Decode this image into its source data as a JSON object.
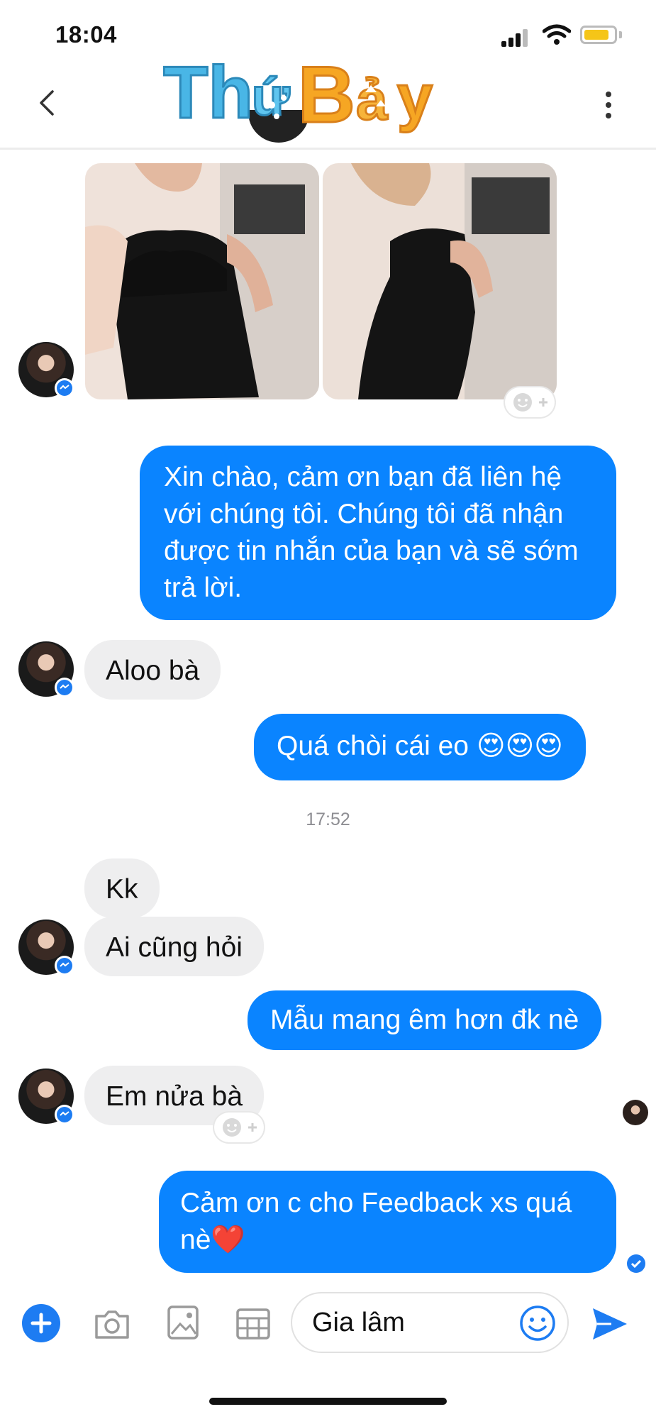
{
  "status_bar": {
    "time": "18:04",
    "battery_level": 0.85
  },
  "header": {
    "logo_text": "Thứ Bảy"
  },
  "messages": {
    "m1": "Xin chào, cảm ơn bạn đã liên hệ với chúng tôi. Chúng tôi đã nhận được tin nhắn của bạn và sẽ sớm trả lời.",
    "m2": "Aloo bà",
    "m3": "Quá chòi cái eo 😍😍😍",
    "timestamp": "17:52",
    "m4": "Kk",
    "m5": "Ai cũng hỏi",
    "m6": "Mẫu mang êm hơn đk nè",
    "m7": "Em nửa bà",
    "m8": "Cảm ơn c cho Feedback xs quá nè❤️"
  },
  "composer": {
    "text": "Gia lâm"
  },
  "colors": {
    "accent": "#0a84ff",
    "incoming_bubble": "#eeeeef"
  },
  "icons": [
    "back-icon",
    "more-icon",
    "plus-icon",
    "camera-icon",
    "image-icon",
    "sticker-icon",
    "emoji-icon",
    "send-icon",
    "messenger-badge-icon",
    "add-reaction-icon",
    "seen-check-icon"
  ]
}
